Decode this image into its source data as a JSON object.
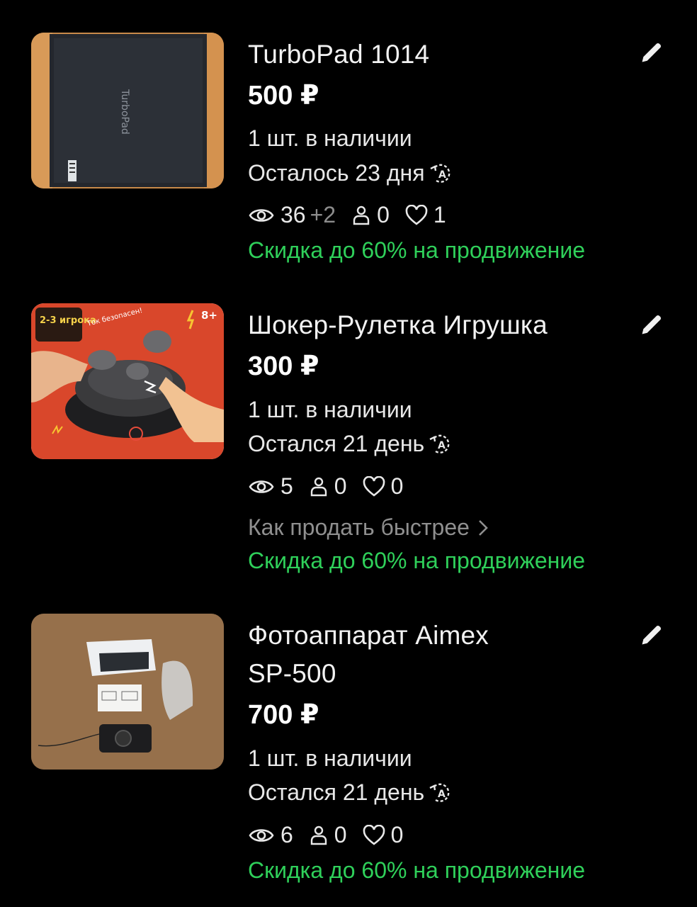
{
  "listings": [
    {
      "title": "TurboPad 1014",
      "price": "500 ₽",
      "stock": "1 шт. в наличии",
      "days_left": "Осталось 23 дня",
      "views": "36",
      "views_delta": "+2",
      "contacts": "0",
      "favorites": "1",
      "promo": "Скидка до 60% на продвижение",
      "image_text": "TurboPad"
    },
    {
      "title": "Шокер-Рулетка Игрушка",
      "price": "300 ₽",
      "stock": "1 шт. в наличии",
      "days_left": "Остался 21 день",
      "views": "5",
      "contacts": "0",
      "favorites": "0",
      "tips": "Как продать быстрее",
      "promo": "Скидка до 60% на продвижение",
      "image_badge_players": "2-3 игрока",
      "image_badge_age": "8+",
      "image_caption": "Ток безопасен!"
    },
    {
      "title_line1": "Фотоаппарат Aimex",
      "title_line2": "SP-500",
      "price": "700 ₽",
      "stock": "1 шт. в наличии",
      "days_left": "Остался 21 день",
      "views": "6",
      "contacts": "0",
      "favorites": "0",
      "promo": "Скидка до 60% на продвижение"
    }
  ],
  "colors": {
    "background": "#000000",
    "text": "#f2f2f2",
    "promo": "#2fd05a",
    "muted": "#8f8f8f"
  },
  "icons": [
    "pencil-icon",
    "eye-icon",
    "person-icon",
    "heart-icon",
    "auto-renew-icon",
    "chevron-right-icon"
  ]
}
